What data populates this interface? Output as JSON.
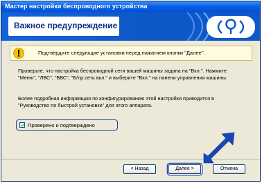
{
  "window": {
    "title": "Мастер настройки беспроводного устройства"
  },
  "header": {
    "title": "Важное предупреждение",
    "logo_icon": "wireless-wave-logo-icon"
  },
  "warning": {
    "icon": "warning-icon",
    "text": "Подтвердите следующие установки перед нажатием кнопки \"Далее\"."
  },
  "body": {
    "paragraph1": "Проверьте, что настройка беспроводной сети вашей машины задана на \"Вкл.\". Нажмите \"Меню\", \"ЛВС\", \"БВС\", \"Б/пр.сеть вкл.\" и выберите \"Вкл.\" на панели управления машины.",
    "paragraph2": "Более подробная информация по конфигурированию этой настройки приводится в \"Руководство по быстрой установке\" для этого аппарата."
  },
  "confirm": {
    "label": "Проверено и подтверждено",
    "checked": true
  },
  "buttons": {
    "back": "< Назад",
    "next": "Далее >",
    "cancel": "Отмена"
  },
  "colors": {
    "header_blue": "#0f58c8",
    "title_bar": "#0054e3",
    "dialog_bg": "#ece9d8",
    "arrow": "#1a46b8"
  }
}
